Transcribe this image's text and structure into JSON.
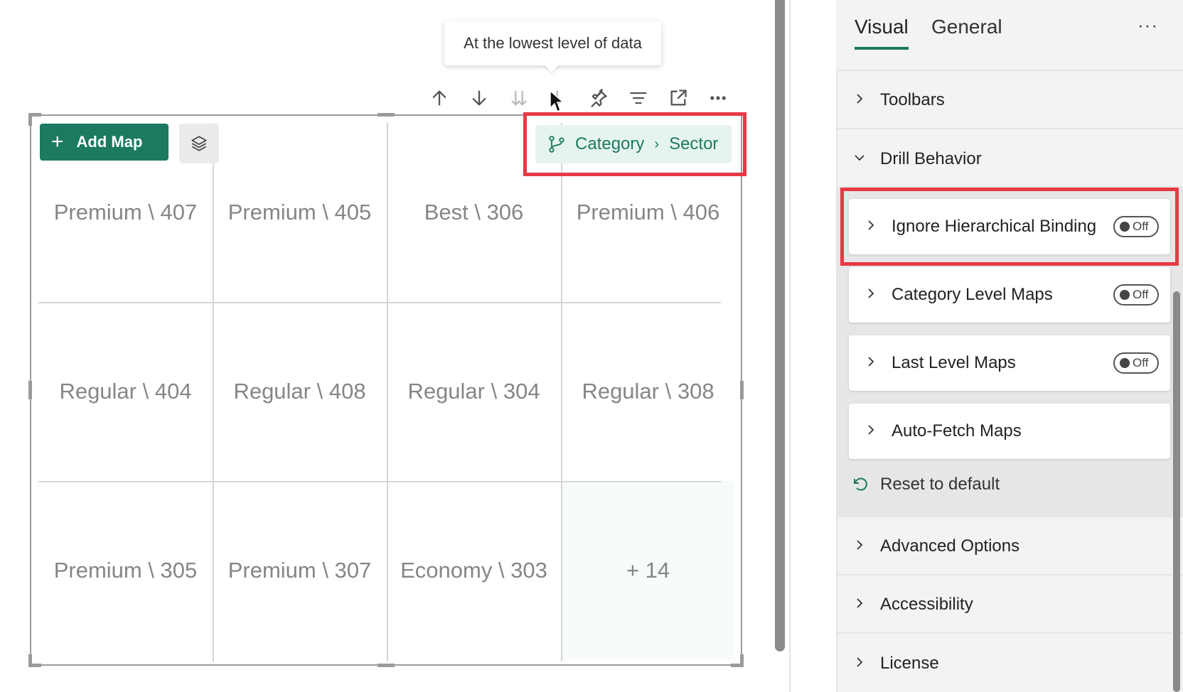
{
  "tooltip": {
    "text": "At the lowest level of data"
  },
  "toolbar": {
    "icons": [
      "drill-up-icon",
      "drill-down-icon",
      "expand-all-down-icon",
      "drill-mode-icon",
      "pin-icon",
      "filter-icon",
      "focus-mode-icon",
      "more-options-icon"
    ]
  },
  "visual": {
    "add_map_label": "Add Map",
    "breadcrumb": {
      "level1": "Category",
      "separator": "›",
      "level2": "Sector"
    },
    "cells": [
      [
        "Premium \\ 407",
        "Premium \\ 405",
        "Best \\ 306",
        "Premium \\ 406"
      ],
      [
        "Regular \\ 404",
        "Regular \\ 408",
        "Regular \\ 304",
        "Regular \\ 308"
      ],
      [
        "Premium \\ 305",
        "Premium \\ 307",
        "Economy \\ 303",
        "+ 14"
      ]
    ]
  },
  "pane": {
    "tabs": [
      "Visual",
      "General"
    ],
    "more_label": "···",
    "sections": {
      "toolbars": "Toolbars",
      "drill_behavior": "Drill Behavior",
      "advanced": "Advanced Options",
      "accessibility": "Accessibility",
      "license": "License"
    },
    "drill_cards": [
      {
        "label": "Ignore Hierarchical Binding",
        "toggle": "Off"
      },
      {
        "label": "Category Level Maps",
        "toggle": "Off"
      },
      {
        "label": "Last Level Maps",
        "toggle": "Off"
      },
      {
        "label": "Auto-Fetch Maps"
      }
    ],
    "reset_label": "Reset to default"
  },
  "colors": {
    "accent": "#1b7a60",
    "highlight": "#e63946",
    "pane_bg": "#f3f3f3"
  }
}
